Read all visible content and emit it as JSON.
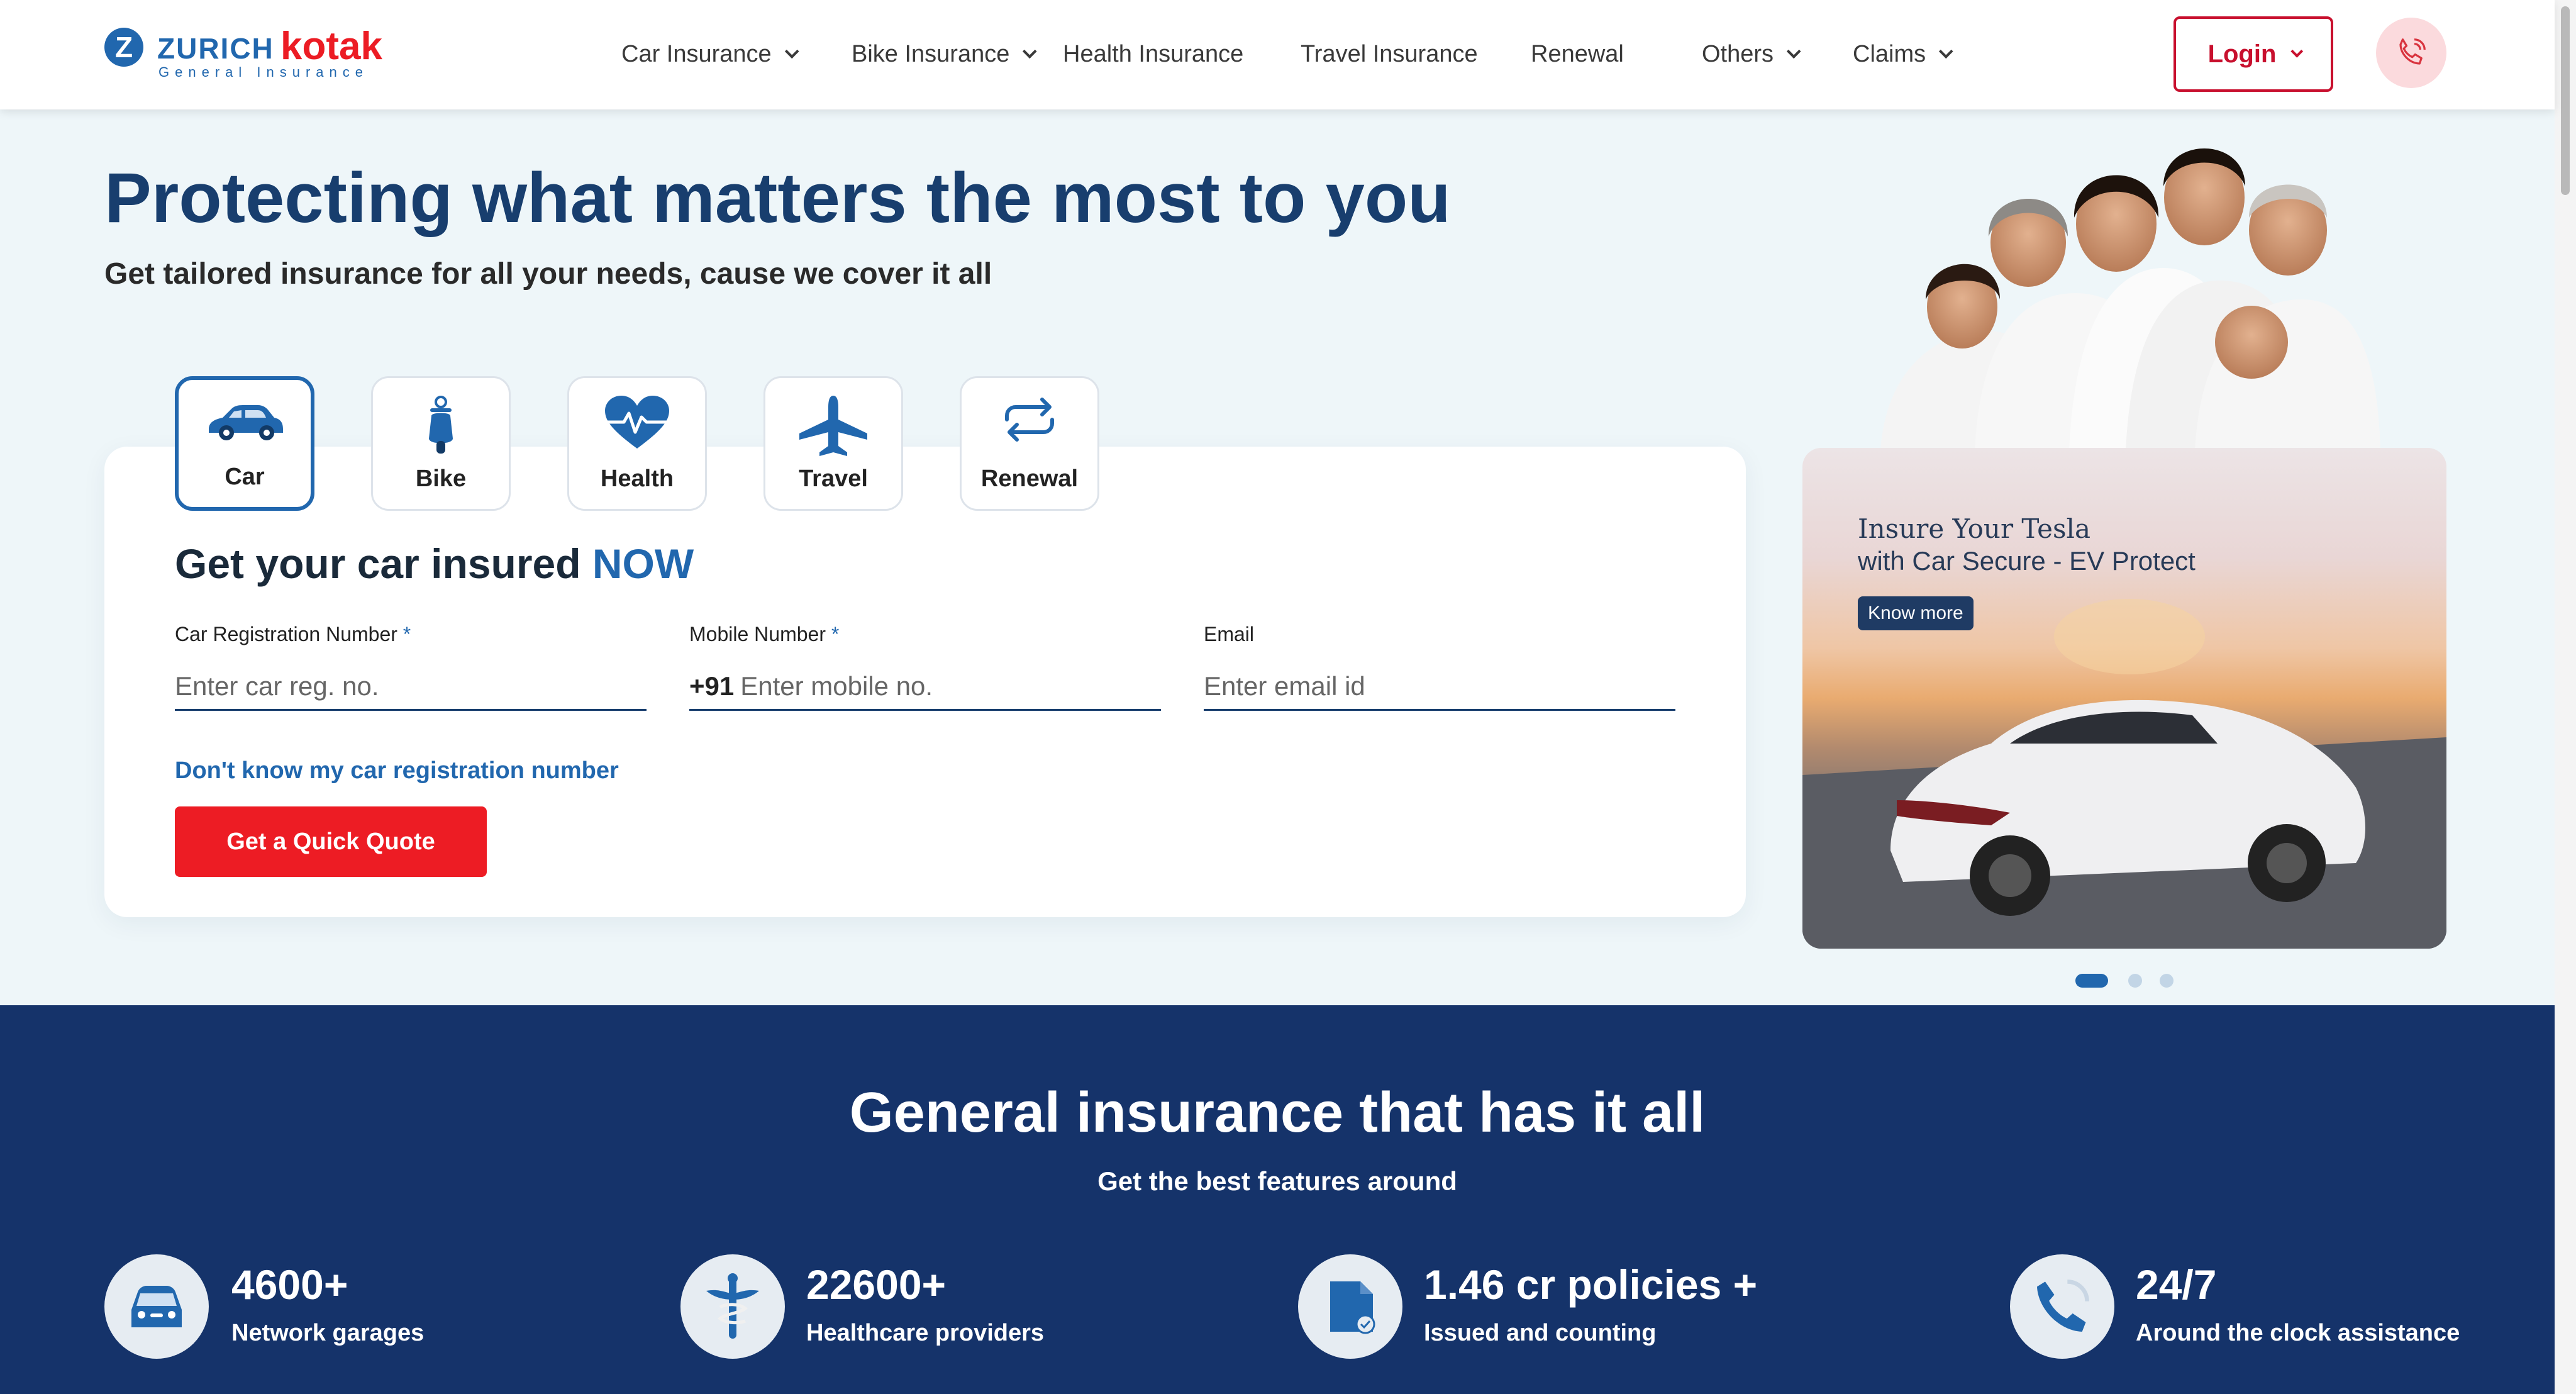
{
  "header": {
    "logo": {
      "brand_a": "ZURICH",
      "brand_b": "kotak",
      "sub": "General Insurance"
    },
    "nav": [
      {
        "label": "Car Insurance",
        "dropdown": true
      },
      {
        "label": "Bike Insurance",
        "dropdown": true
      },
      {
        "label": "Health Insurance",
        "dropdown": false
      },
      {
        "label": "Travel Insurance",
        "dropdown": false
      },
      {
        "label": "Renewal",
        "dropdown": false
      },
      {
        "label": "Others",
        "dropdown": true
      },
      {
        "label": "Claims",
        "dropdown": true
      }
    ],
    "login_label": "Login"
  },
  "hero": {
    "title": "Protecting what matters the most to you",
    "subtitle": "Get tailored insurance for all your needs, cause we cover it all"
  },
  "product_tabs": [
    {
      "label": "Car",
      "icon": "car-icon",
      "active": true
    },
    {
      "label": "Bike",
      "icon": "scooter-icon",
      "active": false
    },
    {
      "label": "Health",
      "icon": "heartbeat-icon",
      "active": false
    },
    {
      "label": "Travel",
      "icon": "airplane-icon",
      "active": false
    },
    {
      "label": "Renewal",
      "icon": "renew-arrows-icon",
      "active": false
    }
  ],
  "form": {
    "heading": "Get your car insured",
    "heading_highlight": "NOW",
    "fields": {
      "reg": {
        "label": "Car Registration Number",
        "required": "*",
        "placeholder": "Enter car reg. no."
      },
      "mobile": {
        "label": "Mobile Number",
        "required": "*",
        "prefix": "+91",
        "placeholder": "Enter mobile no."
      },
      "email": {
        "label": "Email",
        "placeholder": "Enter email id"
      }
    },
    "no_reg_link": "Don't know my car registration number",
    "cta": "Get a Quick Quote"
  },
  "promo": {
    "line1": "Insure Your Tesla",
    "line2": "with Car Secure - EV Protect",
    "button": "Know more",
    "slides": 3,
    "active_slide": 1
  },
  "features": {
    "title": "General insurance that has it all",
    "subtitle": "Get the best features around",
    "stats": [
      {
        "value": "4600+",
        "label": "Network garages",
        "icon": "garage-car-icon"
      },
      {
        "value": "22600+",
        "label": "Healthcare providers",
        "icon": "medical-caduceus-icon"
      },
      {
        "value": "1.46 cr policies +",
        "label": "Issued and counting",
        "icon": "policy-document-icon"
      },
      {
        "value": "24/7",
        "label": "Around the clock assistance",
        "icon": "phone-support-icon"
      }
    ]
  },
  "colors": {
    "brand_blue": "#2167ae",
    "brand_red": "#ed1c24",
    "navy_band": "#15336a",
    "hero_bg": "#eef6f9"
  }
}
